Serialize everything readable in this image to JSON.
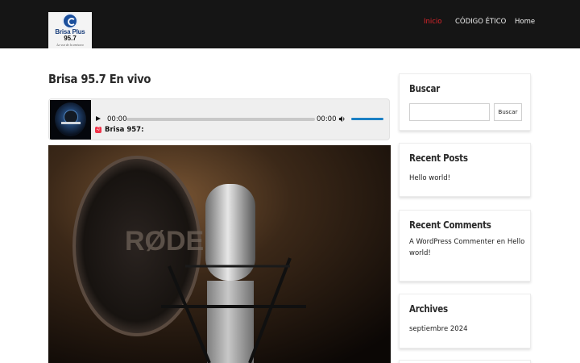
{
  "logo": {
    "name": "Brisa Plus",
    "freq": "95.7",
    "tagline": "La voz de la emisora"
  },
  "nav": {
    "items": [
      {
        "label": "Inicio",
        "active": true
      },
      {
        "label": "CÓDIGO ÉTICO",
        "active": false
      },
      {
        "label": "Home",
        "active": false
      }
    ],
    "active_color": "#e0262c"
  },
  "main": {
    "title": "Brisa 95.7 En vivo",
    "player": {
      "current_time": "00:00",
      "duration": "00:00",
      "station": "Brisa 957:",
      "volume_color": "#1b80c4"
    }
  },
  "sidebar": {
    "search": {
      "title": "Buscar",
      "button_label": "Buscar",
      "placeholder": ""
    },
    "recent_posts": {
      "title": "Recent Posts",
      "items": [
        "Hello world!"
      ]
    },
    "recent_comments": {
      "title": "Recent Comments",
      "line1": "A WordPress Commenter en Hello",
      "line2": "world!"
    },
    "archives": {
      "title": "Archives",
      "items": [
        "septiembre 2024"
      ]
    }
  },
  "colors": {
    "header_bg": "#151515",
    "accent": "#e0262c"
  }
}
